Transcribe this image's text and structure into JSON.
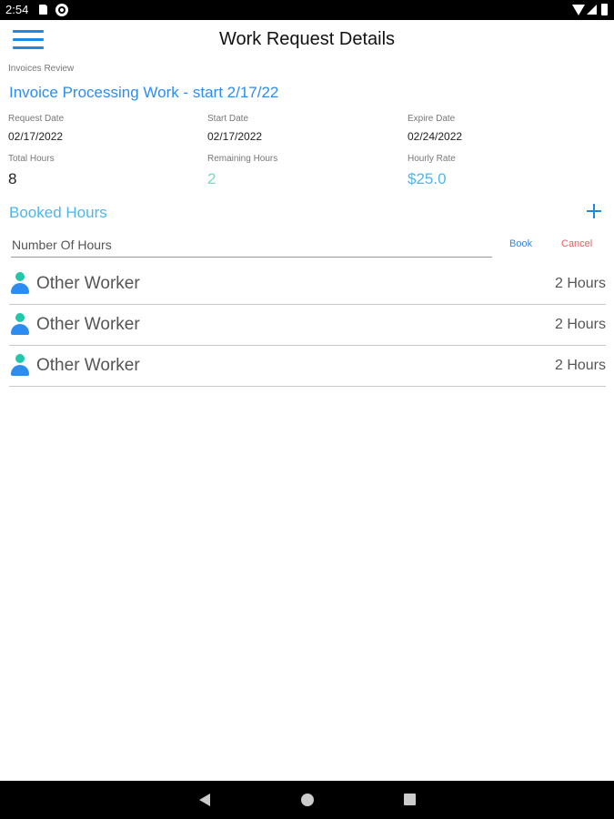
{
  "status_bar": {
    "time": "2:54",
    "icons": [
      "sd-card-icon",
      "sync-icon",
      "wifi-icon",
      "signal-icon",
      "battery-icon"
    ]
  },
  "app_bar": {
    "title": "Work Request Details",
    "menu_icon": "hamburger-menu-icon"
  },
  "work_request": {
    "section_label": "Invoices Review",
    "name": "Invoice Processing Work - start 2/17/22",
    "request_date_label": "Request Date",
    "request_date": "02/17/2022",
    "start_date_label": "Start Date",
    "start_date": "02/17/2022",
    "expire_date_label": "Expire Date",
    "expire_date": "02/24/2022",
    "total_hours_label": "Total Hours",
    "total_hours": "8",
    "remaining_hours_label": "Remaining Hours",
    "remaining_hours": "2",
    "hourly_rate_label": "Hourly Rate",
    "hourly_rate": "$25.0"
  },
  "booked_hours": {
    "title": "Booked Hours",
    "input_placeholder": "Number Of Hours",
    "book_label": "Book",
    "cancel_label": "Cancel",
    "entries": [
      {
        "worker": "Other Worker",
        "hours": "2 Hours"
      },
      {
        "worker": "Other Worker",
        "hours": "2 Hours"
      },
      {
        "worker": "Other Worker",
        "hours": "2 Hours"
      }
    ]
  },
  "colors": {
    "accent_blue": "#2d8cf0",
    "light_blue": "#4fb6e8",
    "remaining_green": "#6fe0b5",
    "cancel_red": "#e35b5b"
  }
}
